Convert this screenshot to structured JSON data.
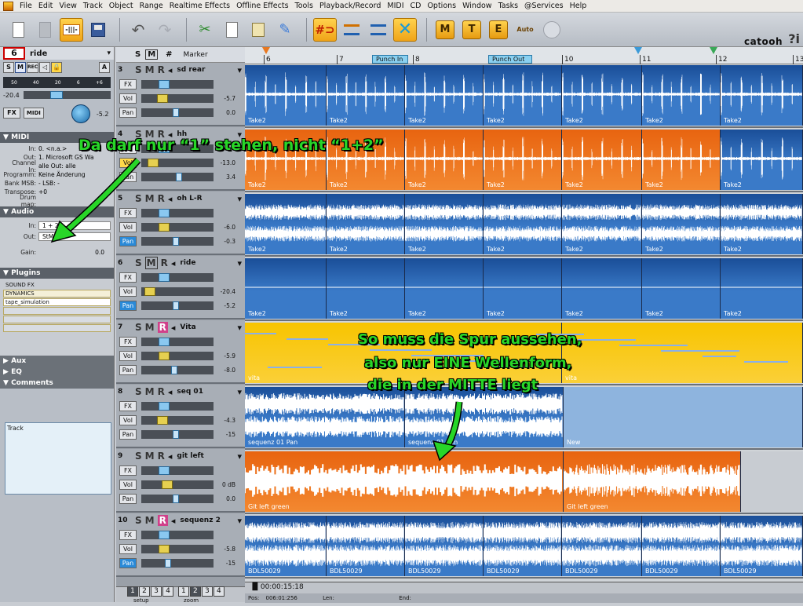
{
  "menu": [
    "File",
    "Edit",
    "View",
    "Track",
    "Object",
    "Range",
    "Realtime Effects",
    "Offline Effects",
    "Tools",
    "Playback/Record",
    "MIDI",
    "CD",
    "Options",
    "Window",
    "Tasks",
    "@Services",
    "Help"
  ],
  "toolbar": {
    "logo": "catooh",
    "help": "?i",
    "wave_icon": "-|||-",
    "auto": "Auto",
    "letters": [
      "M",
      "T",
      "E"
    ]
  },
  "inspector": {
    "track_number": "6",
    "track_name": "ride",
    "buttons": [
      "S",
      "M",
      "REC",
      "A"
    ],
    "level_scale": [
      "50",
      "40",
      "20",
      "6",
      "+6"
    ],
    "level_value": "-20.4",
    "fx_label": "FX",
    "midi_btn": "MIDI",
    "knob_value": "-5.2",
    "midi_section": "MIDI",
    "midi_rows": [
      {
        "label": "In:",
        "value": "0. <n.a.>"
      },
      {
        "label": "Out:",
        "value": "1. Microsoft GS Wa"
      },
      {
        "label": "Channel In:",
        "value": "alle  Out: alle"
      },
      {
        "label": "Programm:",
        "value": "Keine Änderung"
      },
      {
        "label": "Bank MSB:",
        "value": "-          LSB: -"
      },
      {
        "label": "Transpose:",
        "value": "+0"
      },
      {
        "label": "Drum map:",
        "value": ""
      }
    ],
    "audio_section": "Audio",
    "audio_in": "1 + 2",
    "audio_in_label": "In:",
    "audio_out_label": "Out:",
    "audio_out": "StMast",
    "gain_label": "Gain:",
    "gain": "0.0",
    "plugins_section": "Plugins",
    "plugins": [
      "SOUND FX",
      "DYNAMICS",
      "tape_simulation",
      "",
      "",
      ""
    ],
    "aux_section": "Aux",
    "eq_section": "EQ",
    "comments_section": "Comments",
    "comment": "Track"
  },
  "header_top": {
    "s": "S",
    "m": "M",
    "grid": "#",
    "marker": "Marker"
  },
  "tracks": [
    {
      "num": "3",
      "name": "sd rear",
      "vol": "-5.7",
      "pan": "0.0",
      "fx": "FX",
      "vol_lbl": "Vol",
      "pan_lbl": "Pan"
    },
    {
      "num": "4",
      "name": "hh",
      "vol": "-13.0",
      "pan": "3.4",
      "fx": "FX",
      "vol_lbl": "Vol",
      "pan_lbl": "Pan"
    },
    {
      "num": "5",
      "name": "oh L-R",
      "vol": "-6.0",
      "pan": "-0.3",
      "fx": "FX",
      "vol_lbl": "Vol",
      "pan_lbl": "Pan"
    },
    {
      "num": "6",
      "name": "ride",
      "vol": "-20.4",
      "pan": "-5.2",
      "fx": "FX",
      "vol_lbl": "Vol",
      "pan_lbl": "Pan"
    },
    {
      "num": "7",
      "name": "Vita",
      "vol": "-5.9",
      "pan": "-8.0",
      "fx": "FX",
      "vol_lbl": "Vol",
      "pan_lbl": "Pan"
    },
    {
      "num": "8",
      "name": "seq 01",
      "vol": "-4.3",
      "pan": "-15",
      "fx": "FX",
      "vol_lbl": "Vol",
      "pan_lbl": "Pan"
    },
    {
      "num": "9",
      "name": "git left",
      "vol": "0 dB",
      "pan": "0.0",
      "fx": "FX",
      "vol_lbl": "Vol",
      "pan_lbl": "Pan"
    },
    {
      "num": "10",
      "name": "sequenz 2",
      "vol": "-5.8",
      "pan": "-15",
      "fx": "FX",
      "vol_lbl": "Vol",
      "pan_lbl": "Pan"
    }
  ],
  "ruler": {
    "bars": [
      "6",
      "7",
      "8",
      "10",
      "11",
      "12",
      "13"
    ],
    "punch_in": "Punch In",
    "punch_out": "Punch Out"
  },
  "clip_labels": {
    "take2": "Take2",
    "vita": "vita",
    "seq": "sequenz 01 Pan",
    "new": "New",
    "git": "Git left green",
    "bdl": "BDL50029"
  },
  "annotations": {
    "top": "Da darf nur “1” stehen, nicht “1+2”",
    "mid1": "So muss die Spur aussehen,",
    "mid2": "also nur EINE Wellenform,",
    "mid3": "die in der MITTE liegt"
  },
  "footer": {
    "setup": "setup",
    "zoom": "zoom",
    "time": "00:00:15:18",
    "pos": "Pos:",
    "pos_val": "006:01:256",
    "len": "Len:",
    "end": "End:",
    "pages": [
      "1",
      "2",
      "3",
      "4"
    ]
  },
  "colors": {
    "annotation": "#28d628",
    "orange_clip": "#f08020",
    "blue_clip": "#2a66b8",
    "yellow_clip": "#f8c400",
    "rec": "#d0408a"
  }
}
